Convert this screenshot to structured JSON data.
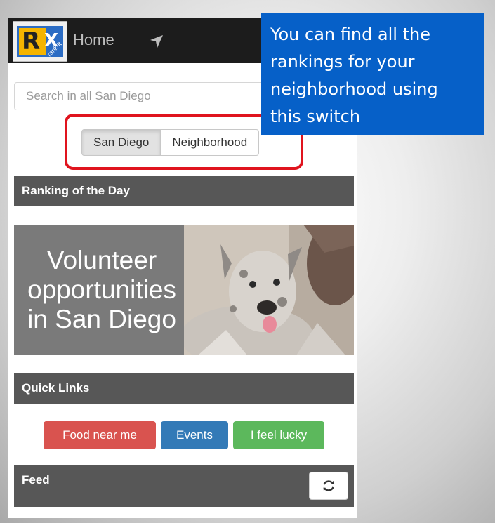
{
  "navbar": {
    "logo": {
      "letter": "R",
      "mark": "X",
      "tag": "rank-it",
      "icon": "rankx-logo"
    },
    "home_label": "Home",
    "location_icon": "navigation-arrow-icon"
  },
  "search": {
    "placeholder": "Search in all San Diego",
    "value": ""
  },
  "scope_toggle": {
    "options": [
      "San Diego",
      "Neighborhood"
    ],
    "selected": "San Diego",
    "highlight_color": "#e0141e"
  },
  "ranking_of_day": {
    "heading": "Ranking of the Day",
    "banner_lines": [
      "Volunteer",
      "opportunities",
      "in San Diego"
    ]
  },
  "quick_links": {
    "heading": "Quick Links",
    "buttons": [
      {
        "label": "Food near me",
        "color": "#d9534f"
      },
      {
        "label": "Events",
        "color": "#337ab7"
      },
      {
        "label": "I feel lucky",
        "color": "#5cb85c"
      }
    ]
  },
  "feed": {
    "heading": "Feed",
    "refresh_icon": "refresh-icon"
  },
  "callout": {
    "lines": [
      "You can find all the",
      "rankings for your",
      "neighborhood using",
      "this switch"
    ],
    "background": "#0660c8"
  }
}
